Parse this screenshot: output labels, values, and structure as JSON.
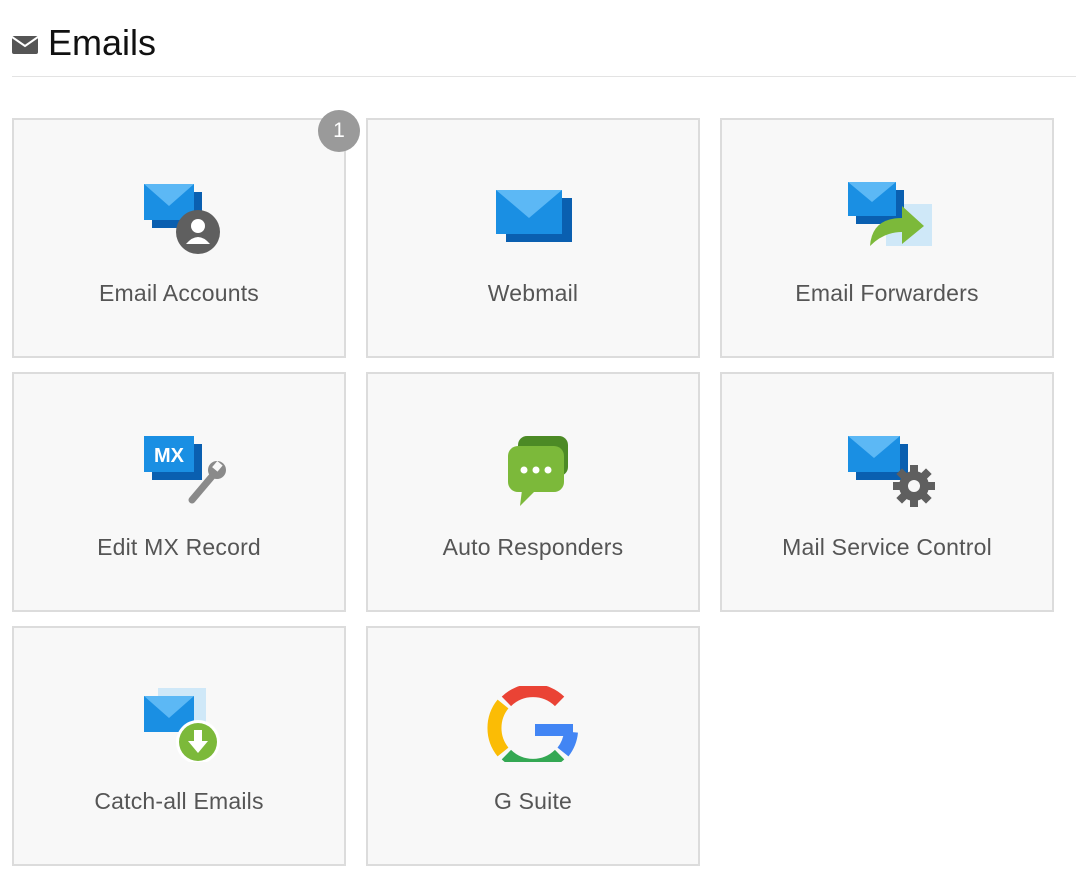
{
  "section": {
    "title": "Emails",
    "icon": "envelope-icon"
  },
  "tiles": [
    {
      "label": "Email Accounts",
      "icon": "email-accounts-icon",
      "badge": "1"
    },
    {
      "label": "Webmail",
      "icon": "webmail-icon"
    },
    {
      "label": "Email Forwarders",
      "icon": "email-forwarders-icon"
    },
    {
      "label": "Edit MX Record",
      "icon": "mx-record-icon",
      "icon_text": "MX"
    },
    {
      "label": "Auto Responders",
      "icon": "auto-responders-icon"
    },
    {
      "label": "Mail Service Control",
      "icon": "mail-service-control-icon"
    },
    {
      "label": "Catch-all Emails",
      "icon": "catch-all-emails-icon"
    },
    {
      "label": "G Suite",
      "icon": "g-suite-icon"
    }
  ],
  "colors": {
    "envelope_blue": "#1a8fe3",
    "envelope_dark": "#0a5fb0",
    "green": "#7cb93a",
    "gray_icon": "#666666",
    "badge": "#9a9a9a"
  }
}
